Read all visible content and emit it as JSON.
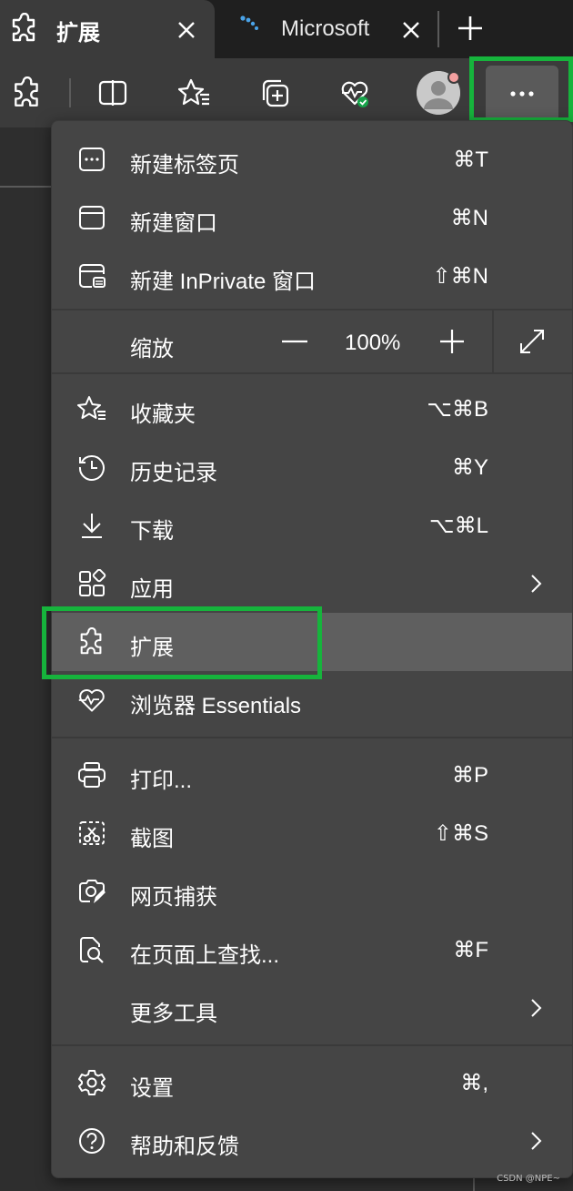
{
  "tabs": [
    {
      "title": "扩展",
      "icon": "puzzle-icon",
      "active": true
    },
    {
      "title": "Microsoft",
      "icon": "loading-spinner-icon",
      "active": false
    }
  ],
  "toolbar": {
    "buttons": [
      "extensions-icon",
      "split-screen-icon",
      "favorites-icon",
      "collections-icon",
      "browser-essentials-icon",
      "profile-avatar",
      "more-icon"
    ]
  },
  "menu": {
    "sections": [
      {
        "items": [
          {
            "label": "新建标签页",
            "shortcut": "⌘T",
            "icon": "new-tab-icon"
          },
          {
            "label": "新建窗口",
            "shortcut": "⌘N",
            "icon": "new-window-icon"
          },
          {
            "label": "新建 InPrivate 窗口",
            "shortcut": "⇧⌘N",
            "icon": "inprivate-icon"
          }
        ]
      }
    ],
    "zoom": {
      "label": "缩放",
      "value": "100%"
    },
    "items_a": [
      {
        "label": "收藏夹",
        "shortcut": "⌥⌘B",
        "icon": "favorites-icon"
      },
      {
        "label": "历史记录",
        "shortcut": "⌘Y",
        "icon": "history-icon"
      },
      {
        "label": "下载",
        "shortcut": "⌥⌘L",
        "icon": "download-icon"
      },
      {
        "label": "应用",
        "shortcut": "",
        "icon": "apps-icon",
        "submenu": true
      },
      {
        "label": "扩展",
        "shortcut": "",
        "icon": "extensions-icon",
        "highlighted": true
      },
      {
        "label": "浏览器 Essentials",
        "shortcut": "",
        "icon": "browser-essentials-icon"
      }
    ],
    "items_b": [
      {
        "label": "打印...",
        "shortcut": "⌘P",
        "icon": "print-icon"
      },
      {
        "label": "截图",
        "shortcut": "⇧⌘S",
        "icon": "screenshot-icon"
      },
      {
        "label": "网页捕获",
        "shortcut": "",
        "icon": "web-capture-icon"
      },
      {
        "label": "在页面上查找...",
        "shortcut": "⌘F",
        "icon": "find-icon"
      },
      {
        "label": "更多工具",
        "shortcut": "",
        "icon": "",
        "submenu": true
      }
    ],
    "items_c": [
      {
        "label": "设置",
        "shortcut": "⌘,",
        "icon": "settings-icon"
      },
      {
        "label": "帮助和反馈",
        "shortcut": "",
        "icon": "help-icon",
        "submenu": true
      }
    ]
  },
  "watermark": "CSDN @NPE~",
  "colors": {
    "highlight_border": "#16b43c",
    "menu_bg": "#454545",
    "hover_bg": "#5f5f5f"
  }
}
